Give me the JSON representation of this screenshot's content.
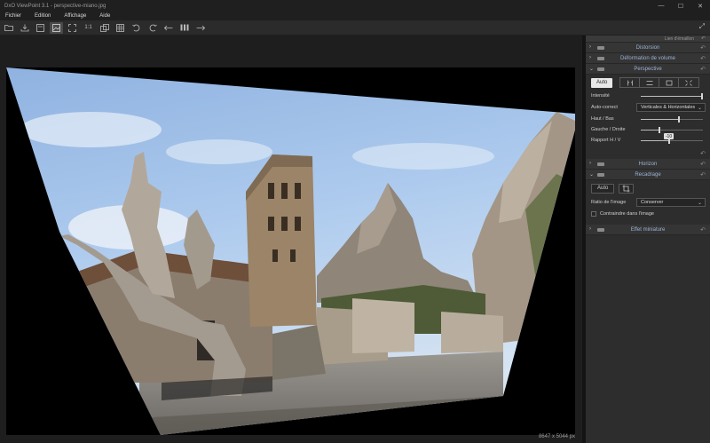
{
  "window": {
    "title": "DxO ViewPoint 3.1 - perspective-miano.jpg",
    "controls": [
      "—",
      "☐",
      "✕"
    ]
  },
  "menu": [
    "Fichier",
    "Edition",
    "Affichage",
    "Aide"
  ],
  "toolbar": {
    "icons": [
      "folder-icon",
      "export-icon",
      "single-view-icon",
      "image-view-icon",
      "fit-icon",
      "one-to-one-icon",
      "compare-icon",
      "grid-icon",
      "undo-icon",
      "redo-icon",
      "prev-icon",
      "filmstrip-icon",
      "next-icon"
    ],
    "zoom_label": "1:1",
    "fullscreen": "⤢"
  },
  "viewer": {
    "dimensions": "8647 x 5044 px"
  },
  "panel": {
    "top_label": "Lien d'émaillon",
    "sections": {
      "distorsion": "Distorsion",
      "volume": "Déformation de volume",
      "perspective": "Perspective",
      "horizon": "Horizon",
      "recadrage": "Recadrage",
      "miniature": "Effet miniature"
    },
    "perspective": {
      "auto_label": "Auto",
      "intensity_label": "Intensité",
      "intensity_value": 1.0,
      "auto_correct_label": "Auto-correct",
      "auto_correct_value": "Verticales & Horizontales",
      "haut_bas_label": "Haut / Bas",
      "haut_bas_value": 0.6,
      "gauche_droite_label": "Gauche / Droite",
      "gauche_droite_value": 0.3,
      "rapport_label": "Rapport H / V",
      "rapport_value": 0.45,
      "rapport_tooltip": "-10"
    },
    "recadrage": {
      "auto_label": "Auto",
      "ratio_label": "Ratio de l'image",
      "ratio_value": "Conserver",
      "constrain_label": "Contraindre dans l'image"
    }
  }
}
